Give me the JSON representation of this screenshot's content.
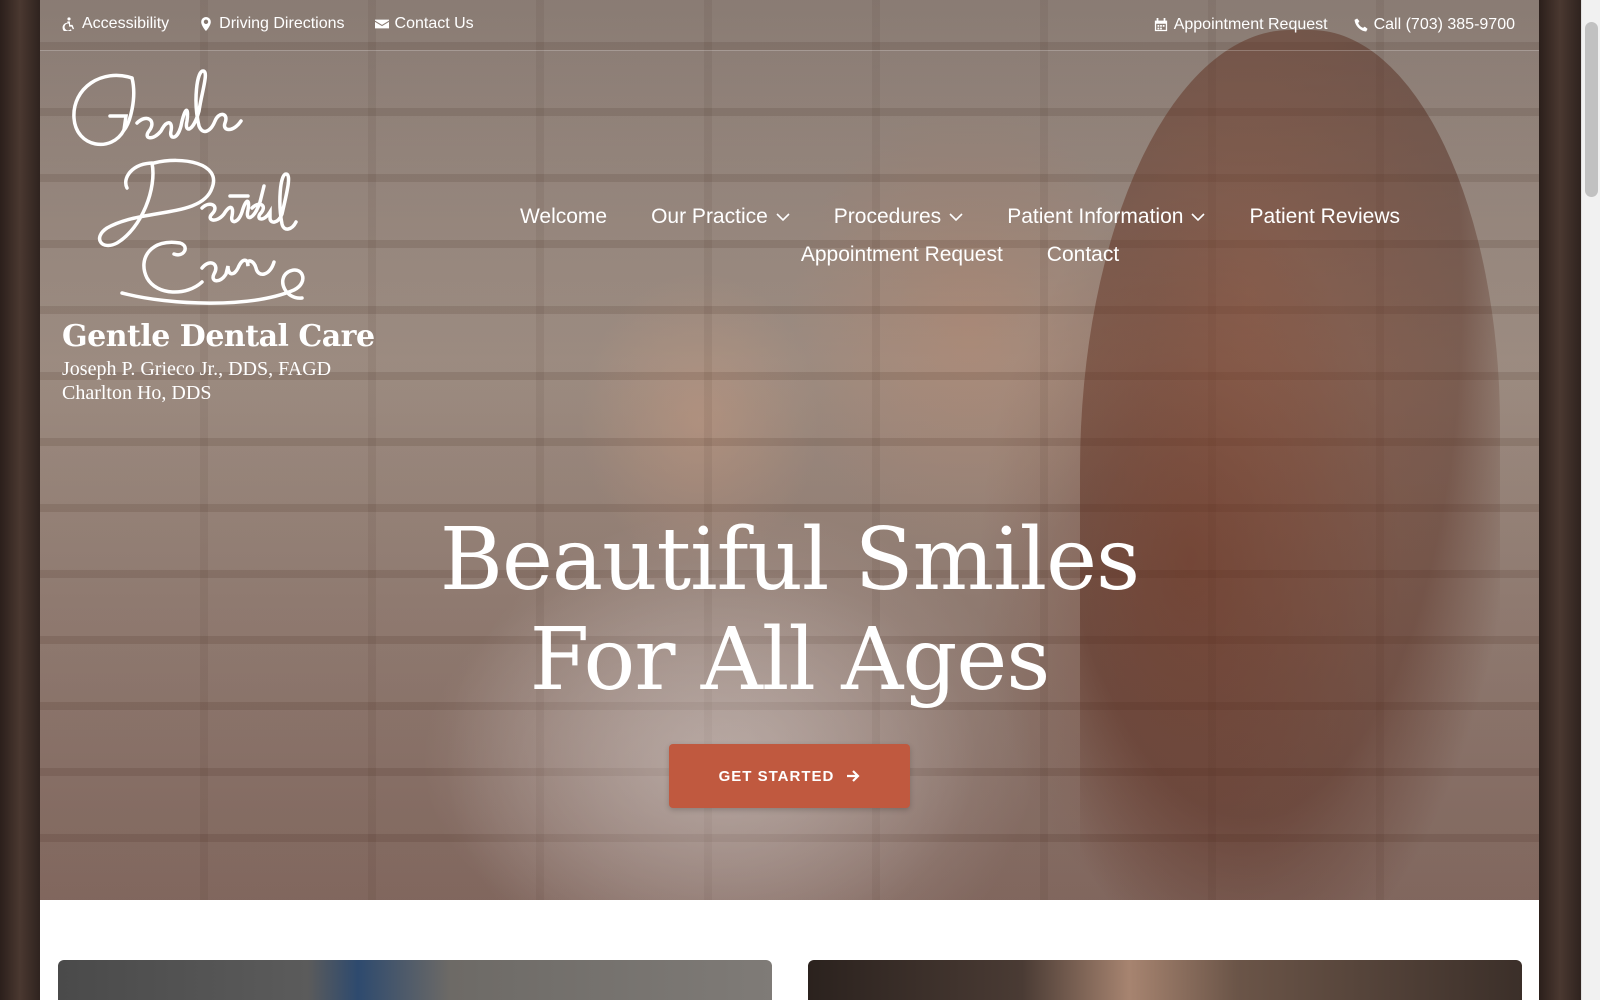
{
  "topbar": {
    "left": [
      {
        "label": "Accessibility",
        "icon": "accessibility-icon"
      },
      {
        "label": "Driving Directions",
        "icon": "map-marker-icon"
      },
      {
        "label": "Contact Us",
        "icon": "envelope-icon"
      }
    ],
    "right": [
      {
        "label": "Appointment Request",
        "icon": "calendar-icon"
      },
      {
        "label": "Call (703) 385-9700",
        "icon": "phone-icon"
      }
    ]
  },
  "logo": {
    "script_text": "Gentle Dental Care",
    "name": "Gentle Dental Care",
    "doctors": [
      "Joseph P. Grieco Jr., DDS, FAGD",
      "Charlton Ho, DDS"
    ]
  },
  "nav": {
    "row1": [
      {
        "label": "Welcome",
        "dropdown": false
      },
      {
        "label": "Our Practice",
        "dropdown": true
      },
      {
        "label": "Procedures",
        "dropdown": true
      },
      {
        "label": "Patient Information",
        "dropdown": true
      },
      {
        "label": "Patient Reviews",
        "dropdown": false
      }
    ],
    "row2": [
      {
        "label": "Appointment Request",
        "dropdown": false
      },
      {
        "label": "Contact",
        "dropdown": false
      }
    ]
  },
  "hero": {
    "headline_line1": "Beautiful Smiles",
    "headline_line2": "For All Ages",
    "cta_label": "GET STARTED"
  },
  "colors": {
    "accent": "#c0593f",
    "text_on_hero": "#ffffff"
  }
}
